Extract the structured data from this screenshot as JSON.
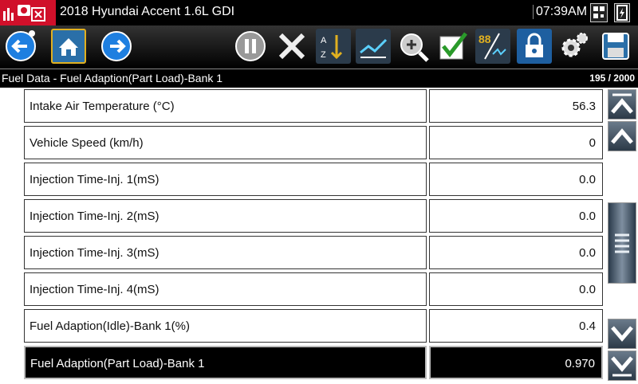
{
  "window": {
    "title": "2018 Hyundai Accent 1.6L GDI",
    "time": "07:39AM"
  },
  "toolbar": {
    "buttons": [
      "back-icon",
      "home-icon",
      "forward-icon",
      "pause-icon",
      "close-icon",
      "sort-icon",
      "graph-icon",
      "zoom-icon",
      "check-icon",
      "units-icon",
      "lock-icon",
      "settings-icon",
      "save-icon"
    ]
  },
  "subheader": {
    "title": "Fuel Data - Fuel Adaption(Part Load)-Bank 1",
    "counter": "195 / 2000"
  },
  "rows": [
    {
      "label": "Intake Air Temperature (°C)",
      "value": "56.3"
    },
    {
      "label": "Vehicle Speed (km/h)",
      "value": "0"
    },
    {
      "label": "Injection Time-Inj. 1(mS)",
      "value": "0.0"
    },
    {
      "label": "Injection Time-Inj. 2(mS)",
      "value": "0.0"
    },
    {
      "label": "Injection Time-Inj. 3(mS)",
      "value": "0.0"
    },
    {
      "label": "Injection Time-Inj. 4(mS)",
      "value": "0.0"
    },
    {
      "label": "Fuel Adaption(Idle)-Bank 1(%)",
      "value": "0.4"
    },
    {
      "label": "Fuel Adaption(Part Load)-Bank 1",
      "value": "0.970",
      "selected": true
    }
  ],
  "colors": {
    "brand": "#d0102a",
    "accent": "#1e90ff",
    "toolbar_bg": "#000000"
  }
}
